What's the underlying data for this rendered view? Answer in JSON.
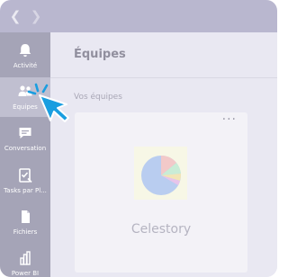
{
  "topbar": {
    "back_icon": "chevron-left-icon",
    "forward_icon": "chevron-right-icon"
  },
  "rail": {
    "items": [
      {
        "label": "Activité",
        "icon": "bell-icon"
      },
      {
        "label": "Équipes",
        "icon": "teams-icon",
        "active": true
      },
      {
        "label": "Conversation",
        "icon": "chat-icon"
      },
      {
        "label": "Tasks par Pl...",
        "icon": "tasks-icon"
      },
      {
        "label": "Fichiers",
        "icon": "file-icon"
      },
      {
        "label": "Power BI",
        "icon": "power-bi-icon"
      }
    ]
  },
  "main": {
    "title": "Équipes",
    "section_label": "Vos équipes",
    "team_card": {
      "more_label": "···",
      "name": "Celestory",
      "avatar_icon": "pie-chart-icon"
    }
  },
  "colors": {
    "topbar": "#b9b7cf",
    "rail": "#a5a4b7",
    "rail_active": "#c0bfd0",
    "cursor": "#1a9ee0"
  }
}
